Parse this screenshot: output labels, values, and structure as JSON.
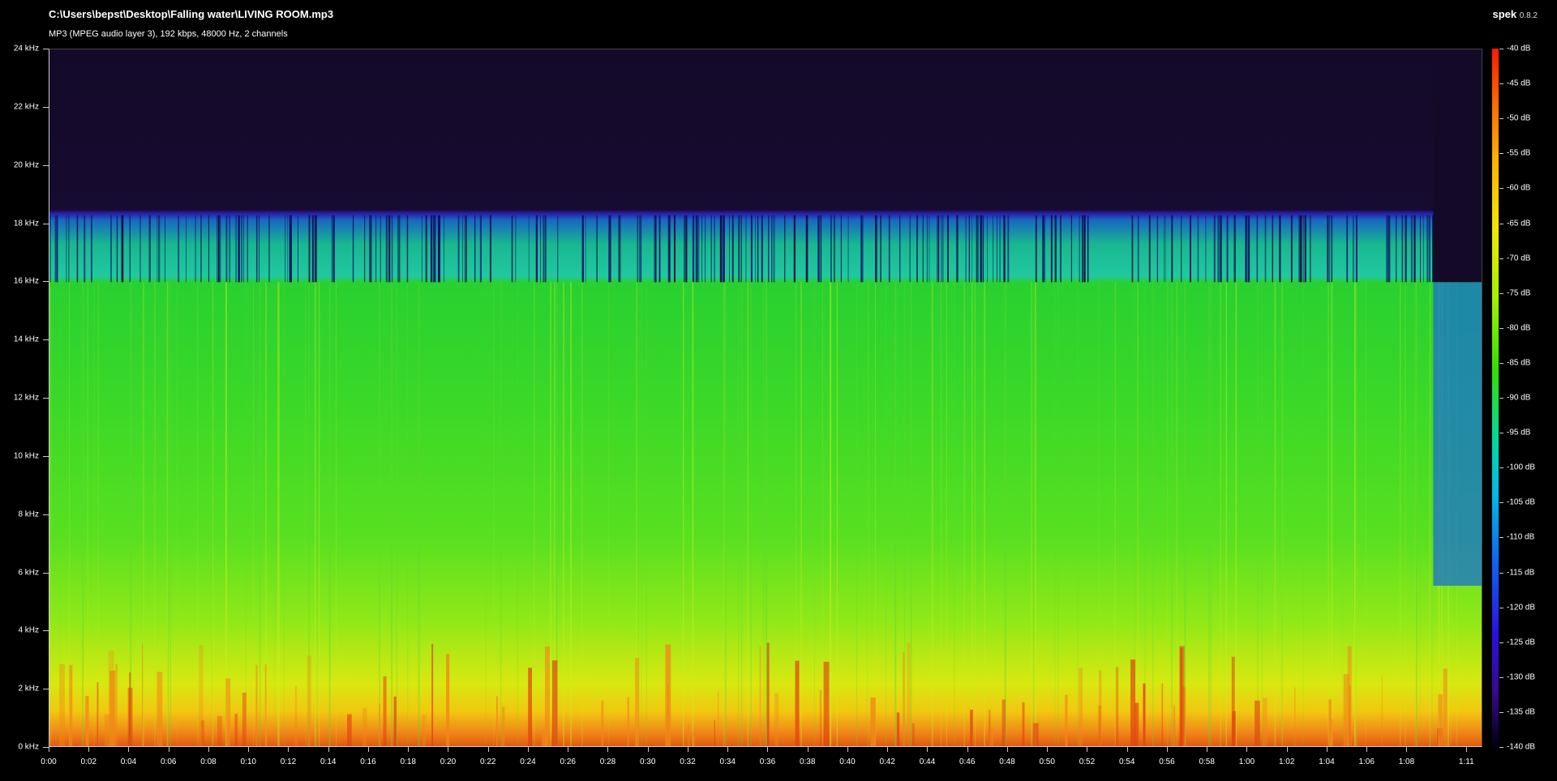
{
  "header": {
    "file_path": "C:\\Users\\bepst\\Desktop\\Falling water\\LIVING ROOM.mp3",
    "file_info": "MP3 (MPEG audio layer 3), 192 kbps, 48000 Hz, 2 channels",
    "app_name": "spek",
    "app_version": "0.8.2"
  },
  "frequency_axis": {
    "ticks": [
      "0 kHz",
      "2 kHz",
      "4 kHz",
      "6 kHz",
      "8 kHz",
      "10 kHz",
      "12 kHz",
      "14 kHz",
      "16 kHz",
      "18 kHz",
      "20 kHz",
      "22 kHz",
      "24 kHz"
    ],
    "max_khz": 24
  },
  "time_axis": {
    "ticks": [
      "0:00",
      "0:02",
      "0:04",
      "0:06",
      "0:08",
      "0:10",
      "0:12",
      "0:14",
      "0:16",
      "0:18",
      "0:20",
      "0:22",
      "0:24",
      "0:26",
      "0:28",
      "0:30",
      "0:32",
      "0:34",
      "0:36",
      "0:38",
      "0:40",
      "0:42",
      "0:44",
      "0:46",
      "0:48",
      "0:50",
      "0:52",
      "0:54",
      "0:56",
      "0:58",
      "1:00",
      "1:02",
      "1:04",
      "1:06",
      "1:08",
      "1:11"
    ],
    "tick_seconds": [
      0,
      2,
      4,
      6,
      8,
      10,
      12,
      14,
      16,
      18,
      20,
      22,
      24,
      26,
      28,
      30,
      32,
      34,
      36,
      38,
      40,
      42,
      44,
      46,
      48,
      50,
      52,
      54,
      56,
      58,
      60,
      62,
      64,
      66,
      68,
      71
    ],
    "duration_seconds": 71.8
  },
  "color_scale": {
    "ticks": [
      "-40 dB",
      "-45 dB",
      "-50 dB",
      "-55 dB",
      "-60 dB",
      "-65 dB",
      "-70 dB",
      "-75 dB",
      "-80 dB",
      "-85 dB",
      "-90 dB",
      "-95 dB",
      "-100 dB",
      "-105 dB",
      "-110 dB",
      "-115 dB",
      "-120 dB",
      "-125 dB",
      "-130 dB",
      "-135 dB",
      "-140 dB"
    ],
    "max_db": -40,
    "min_db": -140
  },
  "spectrogram": {
    "lowpass_cutoff_khz": 16,
    "upper_band_limit_khz": 18.2,
    "colors": {
      "background": "#000000",
      "noise_floor": "#140a28",
      "high_band": "#18b890",
      "mid_band": "#3ad828",
      "low_band": "#d8e810",
      "bass": "#e05a10"
    }
  }
}
